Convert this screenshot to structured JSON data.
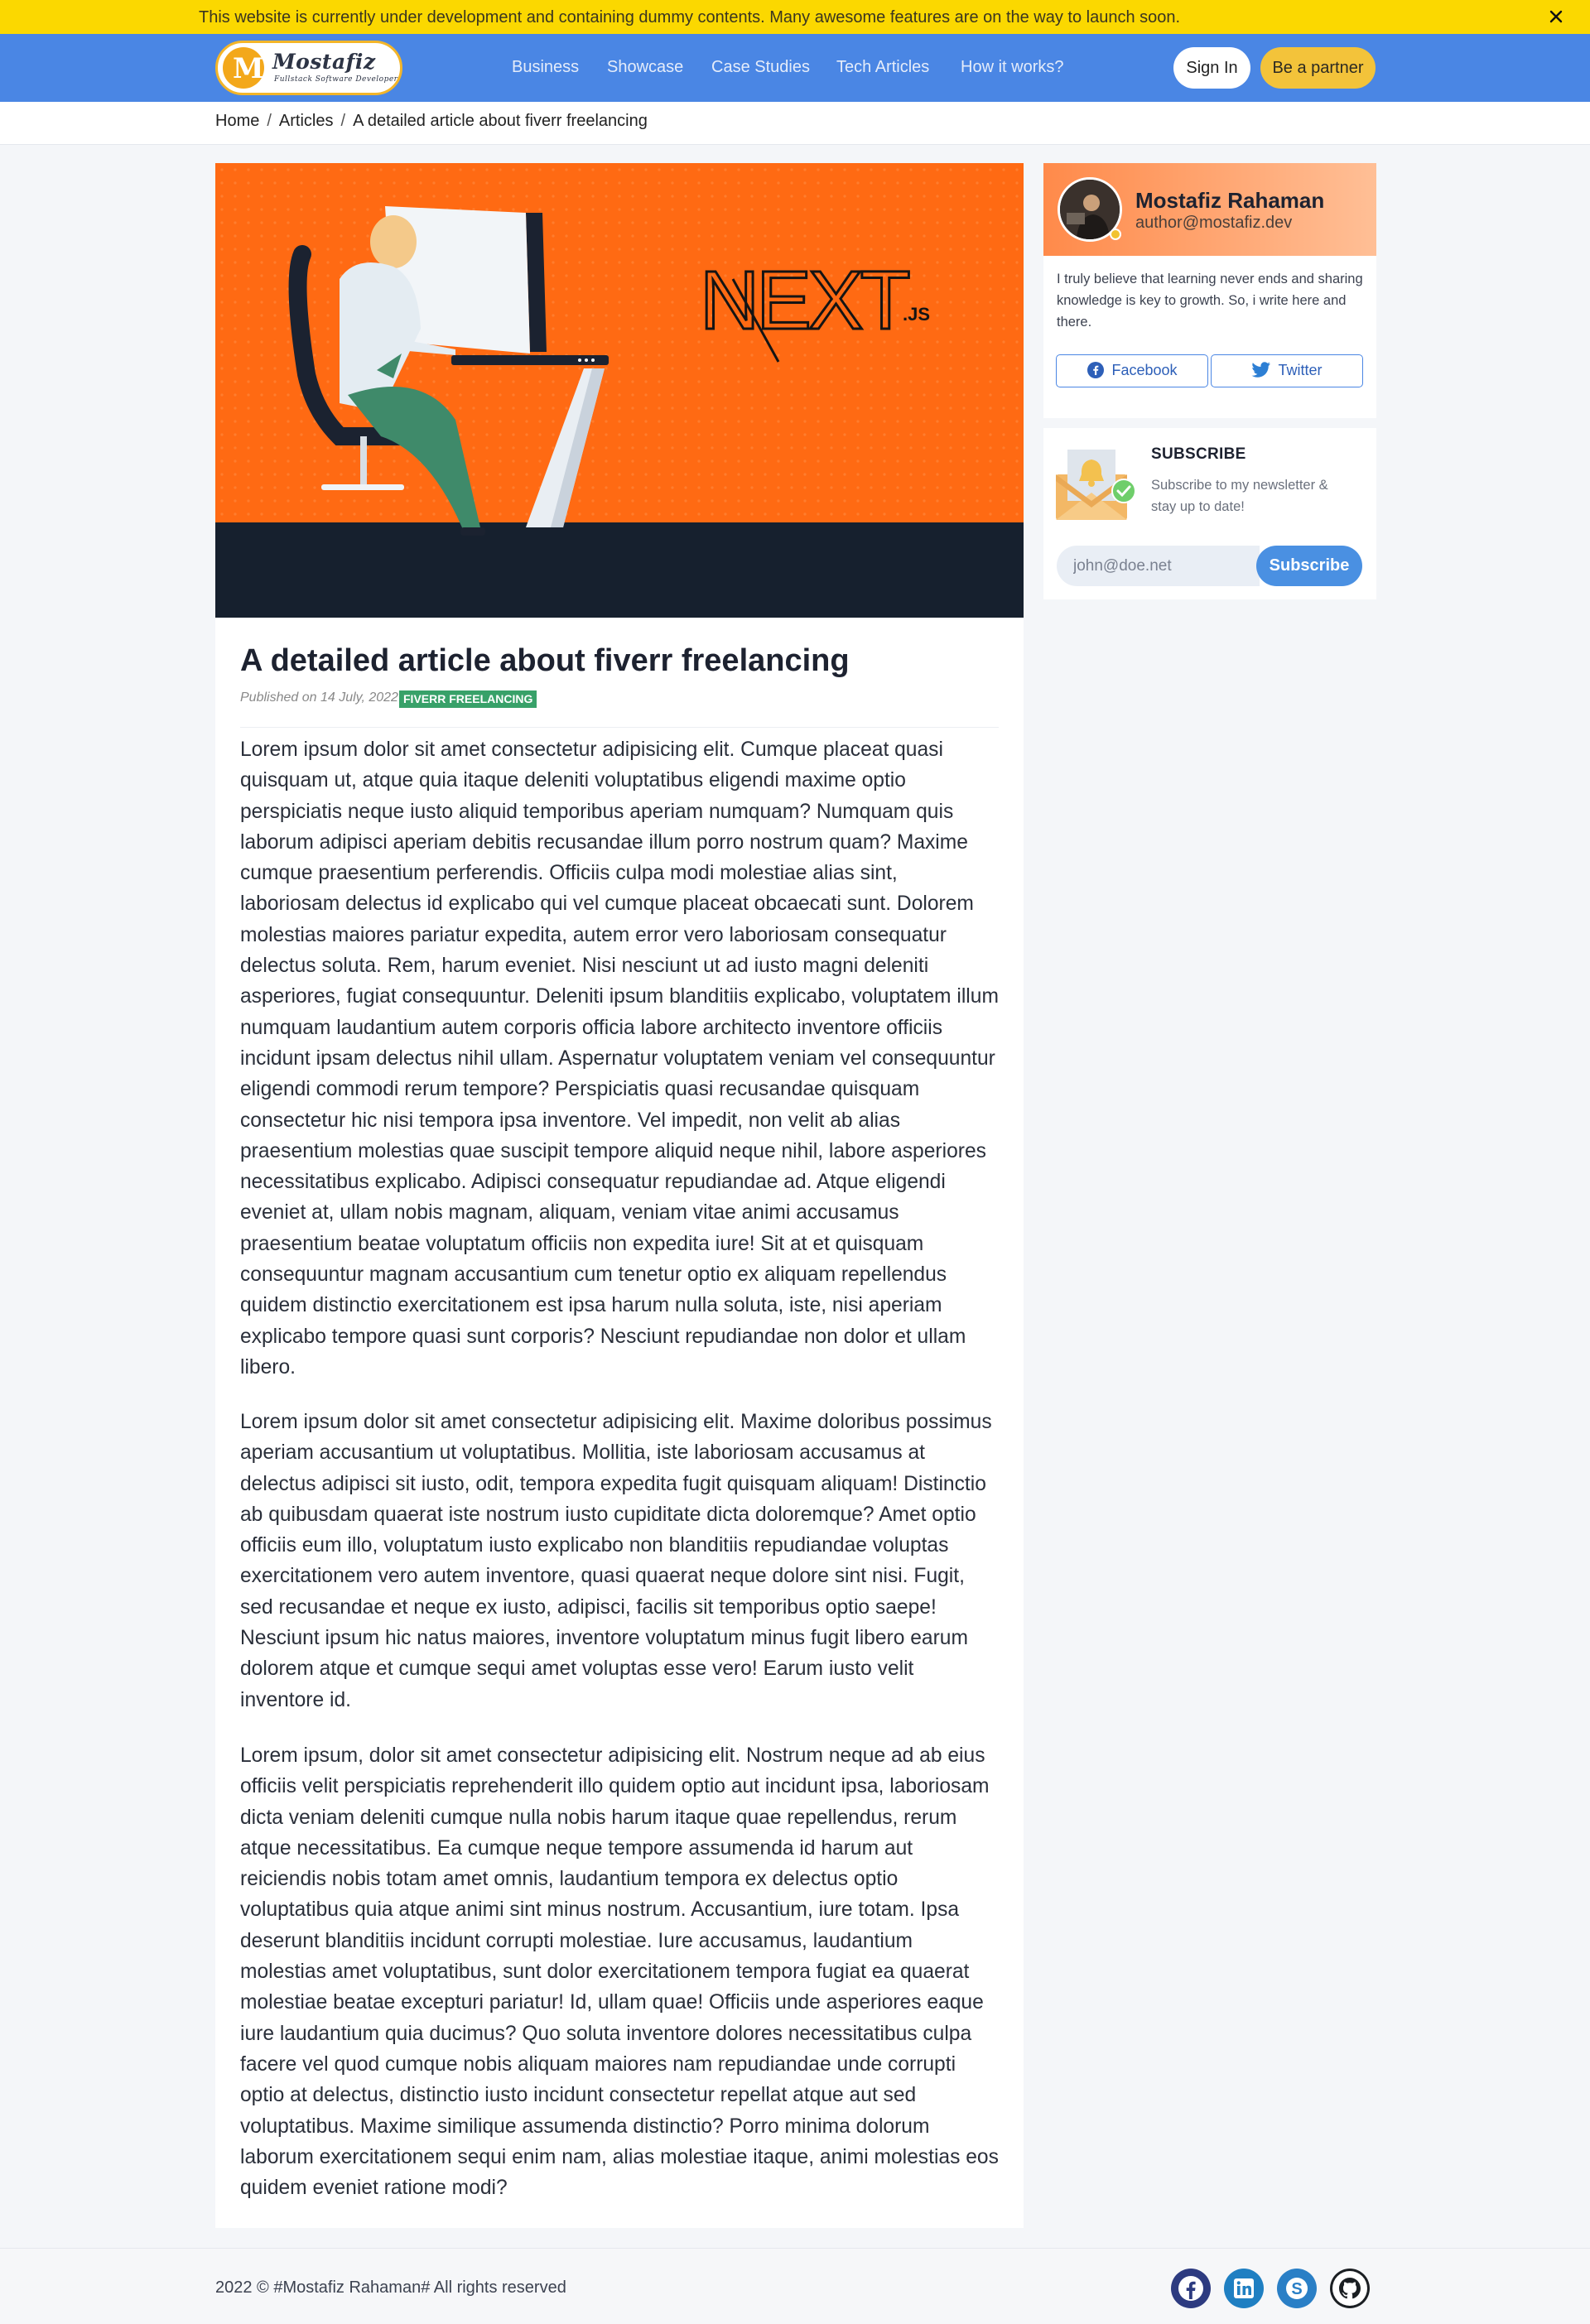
{
  "banner": {
    "message": "This website is currently under development and containing dummy contents. Many awesome features are on the way to launch soon.",
    "close_icon": "close-icon"
  },
  "brand": {
    "initial": "M",
    "name": "Mostafiz",
    "tagline": "Fullstack Software Developer"
  },
  "nav": {
    "links": [
      "Business",
      "Showcase",
      "Case Studies",
      "Tech Articles",
      "How it works?"
    ],
    "signin_label": "Sign In",
    "partner_label": "Be a partner"
  },
  "breadcrumb": [
    "Home",
    "Articles",
    "A detailed article about fiverr freelancing"
  ],
  "article": {
    "hero_logo_text": "NEXT",
    "hero_logo_suffix": ".JS",
    "title": "A detailed article about fiverr freelancing",
    "published": "Published on 14 July, 2022",
    "category": "FIVERR FREELANCING",
    "paragraphs": [
      "Lorem ipsum dolor sit amet consectetur adipisicing elit. Cumque placeat quasi quisquam ut, atque quia itaque deleniti voluptatibus eligendi maxime optio perspiciatis neque iusto aliquid temporibus aperiam numquam? Numquam quis laborum adipisci aperiam debitis recusandae illum porro nostrum quam? Maxime cumque praesentium perferendis. Officiis culpa modi molestiae alias sint, laboriosam delectus id explicabo qui vel cumque placeat obcaecati sunt. Dolorem molestias maiores pariatur expedita, autem error vero laboriosam consequatur delectus soluta. Rem, harum eveniet. Nisi nesciunt ut ad iusto magni deleniti asperiores, fugiat consequuntur. Deleniti ipsum blanditiis explicabo, voluptatem illum numquam laudantium autem corporis officia labore architecto inventore officiis incidunt ipsam delectus nihil ullam. Aspernatur voluptatem veniam vel consequuntur eligendi commodi rerum tempore? Perspiciatis quasi recusandae quisquam consectetur hic nisi tempora ipsa inventore. Vel impedit, non velit ab alias praesentium molestias quae suscipit tempore aliquid neque nihil, labore asperiores necessitatibus explicabo. Adipisci consequatur repudiandae ad. Atque eligendi eveniet at, ullam nobis magnam, aliquam, veniam vitae animi accusamus praesentium beatae voluptatum officiis non expedita iure! Sit at et quisquam consequuntur magnam accusantium cum tenetur optio ex aliquam repellendus quidem distinctio exercitationem est ipsa harum nulla soluta, iste, nisi aperiam explicabo tempore quasi sunt corporis? Nesciunt repudiandae non dolor et ullam libero.",
      "Lorem ipsum dolor sit amet consectetur adipisicing elit. Maxime doloribus possimus aperiam accusantium ut voluptatibus. Mollitia, iste laboriosam accusamus at delectus adipisci sit iusto, odit, tempora expedita fugit quisquam aliquam! Distinctio ab quibusdam quaerat iste nostrum iusto cupiditate dicta doloremque? Amet optio officiis eum illo, voluptatum iusto explicabo non blanditiis repudiandae voluptas exercitationem vero autem inventore, quasi quaerat neque dolore sint nisi. Fugit, sed recusandae et neque ex iusto, adipisci, facilis sit temporibus optio saepe! Nesciunt ipsum hic natus maiores, inventore voluptatum minus fugit libero earum dolorem atque et cumque sequi amet voluptas esse vero! Earum iusto velit inventore id.",
      "Lorem ipsum, dolor sit amet consectetur adipisicing elit. Nostrum neque ad ab eius officiis velit perspiciatis reprehenderit illo quidem optio aut incidunt ipsa, laboriosam dicta veniam deleniti cumque nulla nobis harum itaque quae repellendus, rerum atque necessitatibus. Ea cumque neque tempore assumenda id harum aut reiciendis nobis totam amet omnis, laudantium tempora ex delectus optio voluptatibus quia atque animi sint minus nostrum. Accusantium, iure totam. Ipsa deserunt blanditiis incidunt corrupti molestiae. Iure accusamus, laudantium molestias amet voluptatibus, sunt dolor exercitationem tempora fugiat ea quaerat molestiae beatae excepturi pariatur! Id, ullam quae! Officiis unde asperiores eaque iure laudantium quia ducimus? Quo soluta inventore dolores necessitatibus culpa facere vel quod cumque nobis aliquam maiores nam repudiandae unde corrupti optio at delectus, distinctio iusto incidunt consectetur repellat atque aut sed voluptatibus. Maxime similique assumenda distinctio? Porro minima dolorum laborum exercitationem sequi enim nam, alias molestiae itaque, animi molestias eos quidem eveniet ratione modi?"
    ]
  },
  "author": {
    "name": "Mostafiz Rahaman",
    "email": "author@mostafiz.dev",
    "bio": "I truly believe that learning never ends and sharing knowledge is key to growth. So, i write here and there.",
    "facebook_label": "Facebook",
    "twitter_label": "Twitter"
  },
  "subscribe": {
    "title": "SUBSCRIBE",
    "description": "Subscribe to my newsletter & stay up to date!",
    "placeholder": "john@doe.net",
    "button_label": "Subscribe"
  },
  "footer": {
    "copyright": "2022 © #Mostafiz Rahaman# All rights reserved",
    "icons": [
      "facebook-icon",
      "linkedin-icon",
      "skype-icon",
      "github-icon"
    ]
  },
  "colors": {
    "banner": "#fbd800",
    "navbar": "#4a86e4",
    "hero_orange": "#ff6a13",
    "hero_dark": "#16202e",
    "badge": "#38a169",
    "subscribe_button": "#4a90e2"
  }
}
